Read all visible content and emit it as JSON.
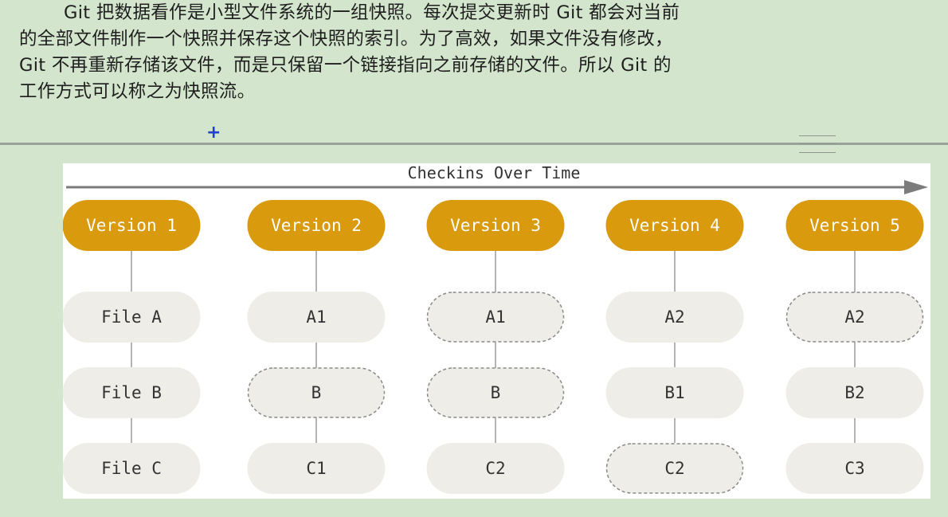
{
  "paragraph": {
    "lines": [
      "Git 把数据看作是小型文件系统的一组快照。每次提交更新时 Git 都会对当前",
      "的全部文件制作一个快照并保存这个快照的索引。为了高效，如果文件没有修改，",
      "Git 不再重新存储该文件，而是只保留一个链接指向之前存储的文件。所以 Git 的",
      "工作方式可以称之为快照流。"
    ]
  },
  "cursor_glyph": "+",
  "diagram": {
    "title": "Checkins Over Time",
    "colors": {
      "version_fill": "#d99a0e",
      "version_text": "#ffffff",
      "file_fill": "#efede7",
      "file_text": "#333333",
      "dashed_border": "#8a8a8a",
      "connector": "#9b9b9b",
      "arrow": "#7c7c7c"
    },
    "versions": [
      {
        "label": "Version 1",
        "files": [
          {
            "label": "File A",
            "dashed": false
          },
          {
            "label": "File B",
            "dashed": false
          },
          {
            "label": "File C",
            "dashed": false
          }
        ]
      },
      {
        "label": "Version 2",
        "files": [
          {
            "label": "A1",
            "dashed": false
          },
          {
            "label": "B",
            "dashed": true
          },
          {
            "label": "C1",
            "dashed": false
          }
        ]
      },
      {
        "label": "Version 3",
        "files": [
          {
            "label": "A1",
            "dashed": true
          },
          {
            "label": "B",
            "dashed": true
          },
          {
            "label": "C2",
            "dashed": false
          }
        ]
      },
      {
        "label": "Version 4",
        "files": [
          {
            "label": "A2",
            "dashed": false
          },
          {
            "label": "B1",
            "dashed": false
          },
          {
            "label": "C2",
            "dashed": true
          }
        ]
      },
      {
        "label": "Version 5",
        "files": [
          {
            "label": "A2",
            "dashed": true
          },
          {
            "label": "B2",
            "dashed": false
          },
          {
            "label": "C3",
            "dashed": false
          }
        ]
      }
    ]
  }
}
